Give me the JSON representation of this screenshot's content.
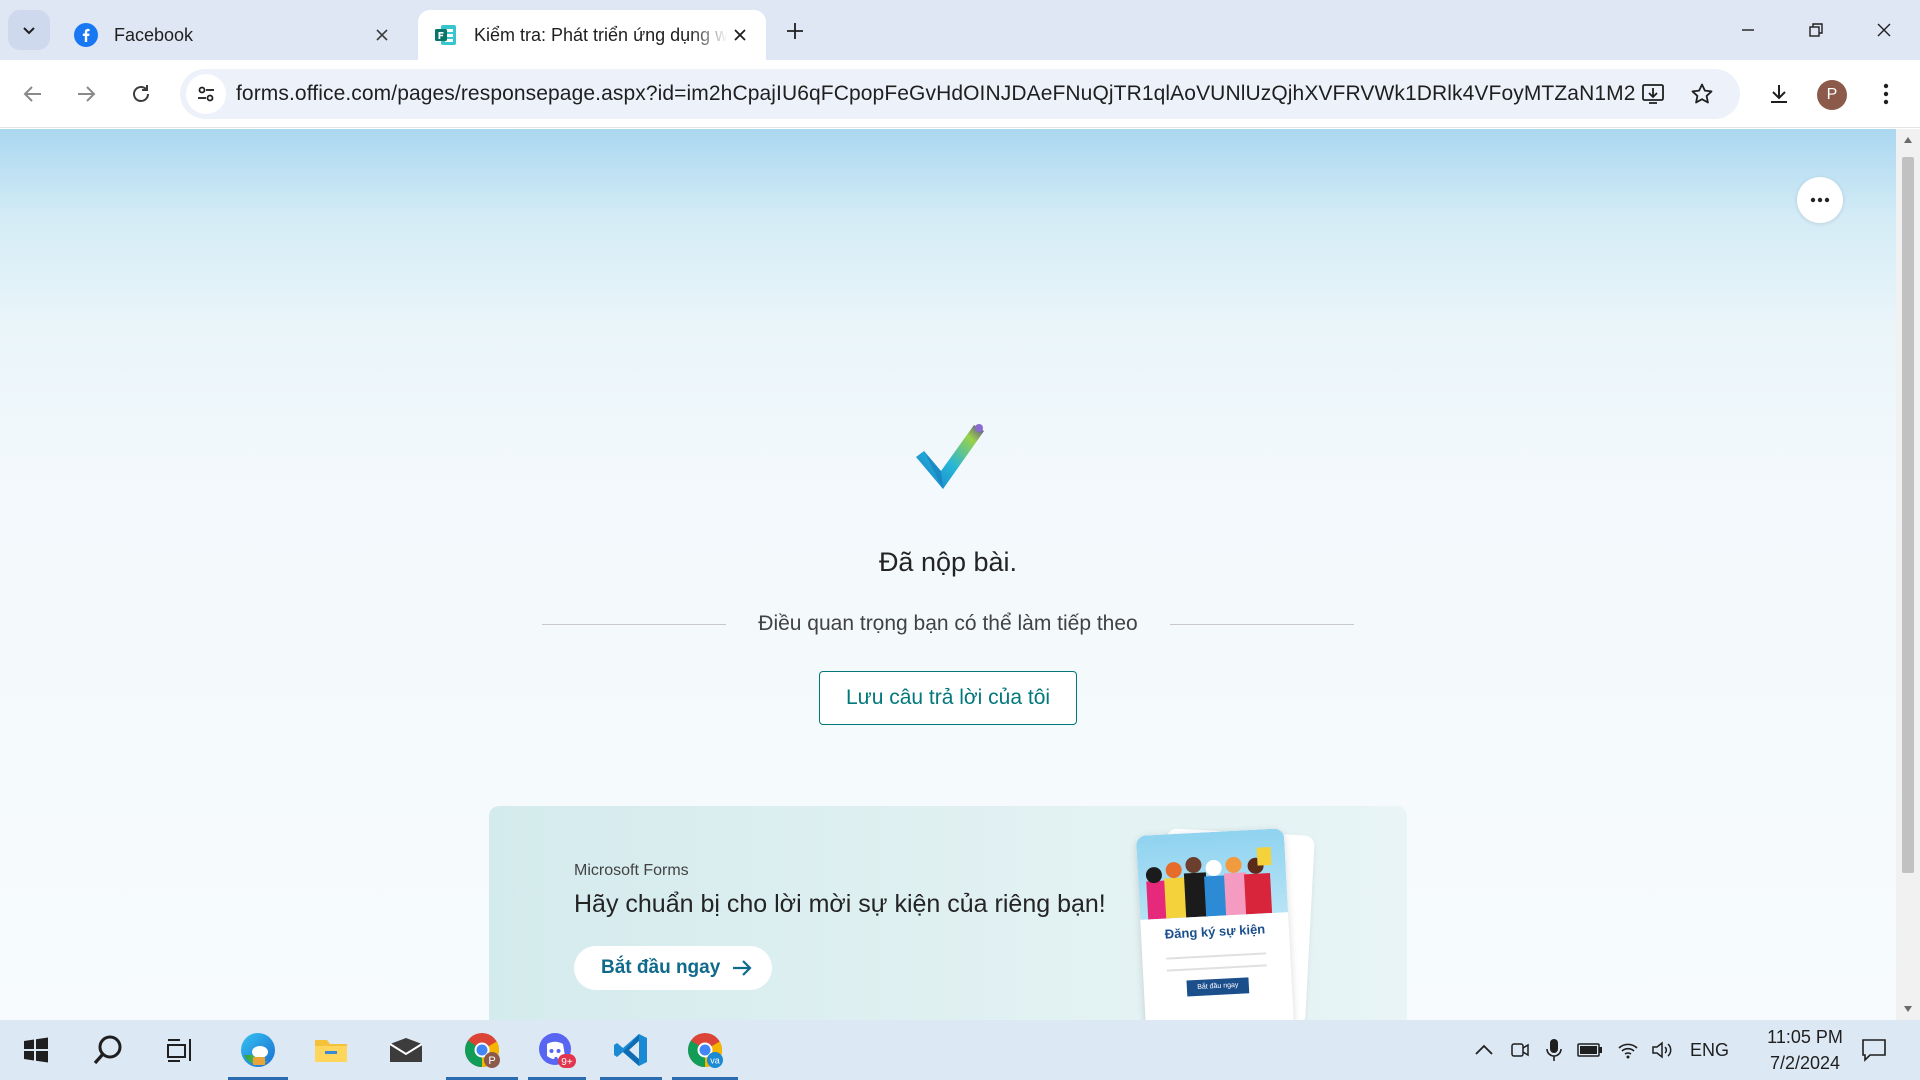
{
  "browser": {
    "tabs": [
      {
        "title": "Facebook",
        "icon": "facebook-icon"
      },
      {
        "title": "Kiểm tra: Phát triển ứng dụng w",
        "icon": "microsoft-forms-icon",
        "active": true
      }
    ],
    "url": "forms.office.com/pages/responsepage.aspx?id=im2hCpajIU6qFCpopFeGvHdOINJDAeFNuQjTR1qlAoVUNlUzQjhXVFRVWk1DRlk4VFoyMTZaN1M2NC4u",
    "profile_initial": "P"
  },
  "page": {
    "heading": "Đã nộp bài.",
    "subtitle": "Điều quan trọng bạn có thể làm tiếp theo",
    "save_button": "Lưu câu trả lời của tôi",
    "promo": {
      "brand": "Microsoft Forms",
      "title": "Hãy chuẩn bị cho lời mời sự kiện của riêng bạn!",
      "cta": "Bắt đầu ngay",
      "card_title": "Đăng ký sự kiện",
      "card_button": "Bắt đầu ngay"
    }
  },
  "taskbar": {
    "language": "ENG",
    "time": "11:05 PM",
    "date": "7/2/2024",
    "apps": [
      "start-icon",
      "search-icon",
      "task-view-icon",
      "edge-icon",
      "file-explorer-icon",
      "mail-icon",
      "chrome-profile-p-icon",
      "discord-icon",
      "vscode-icon",
      "chrome-profile-va-icon"
    ],
    "discord_badge": "9+",
    "chrome_badge_1": "P",
    "chrome_badge_2": "va"
  },
  "colors": {
    "accent": "#03787c",
    "tab_strip": "#dfe6f4",
    "promo_bg": "#d4ebed",
    "taskbar": "#dce8f3"
  }
}
